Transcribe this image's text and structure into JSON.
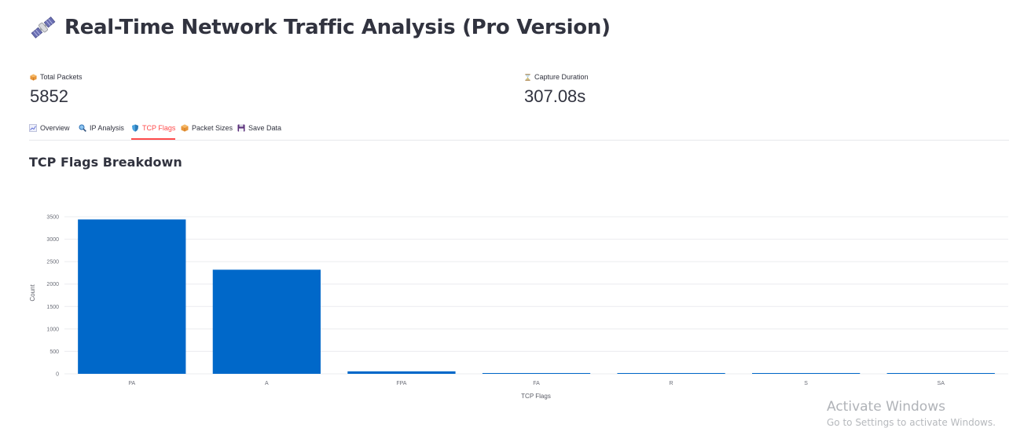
{
  "header": {
    "title": "Real-Time Network Traffic Analysis (Pro Version)",
    "icon": "satellite-icon"
  },
  "metrics": [
    {
      "label": "Total Packets",
      "value": "5852",
      "icon": "package-icon"
    },
    {
      "label": "Capture Duration",
      "value": "307.08s",
      "icon": "hourglass-icon"
    }
  ],
  "tabs": [
    {
      "label": "Overview",
      "icon": "chart-icon",
      "active": false
    },
    {
      "label": "IP Analysis",
      "icon": "magnifier-icon",
      "active": false
    },
    {
      "label": "TCP Flags",
      "icon": "shield-icon",
      "active": true
    },
    {
      "label": "Packet Sizes",
      "icon": "package-icon",
      "active": false
    },
    {
      "label": "Save Data",
      "icon": "floppy-disk-icon",
      "active": false
    }
  ],
  "section": {
    "title": "TCP Flags Breakdown"
  },
  "colors": {
    "bar": "#0068c9",
    "accent": "#ff4b4b",
    "text": "#31333f"
  },
  "chart_data": {
    "type": "bar",
    "categories": [
      "PA",
      "A",
      "FPA",
      "FA",
      "R",
      "S",
      "SA"
    ],
    "values": [
      3440,
      2320,
      55,
      5,
      3,
      2,
      2
    ],
    "xlabel": "TCP Flags",
    "ylabel": "Count",
    "ylim": [
      0,
      3500
    ],
    "yticks": [
      0,
      500,
      1000,
      1500,
      2000,
      2500,
      3000,
      3500
    ],
    "grid": true
  },
  "watermark": {
    "title": "Activate Windows",
    "subtitle": "Go to Settings to activate Windows."
  }
}
